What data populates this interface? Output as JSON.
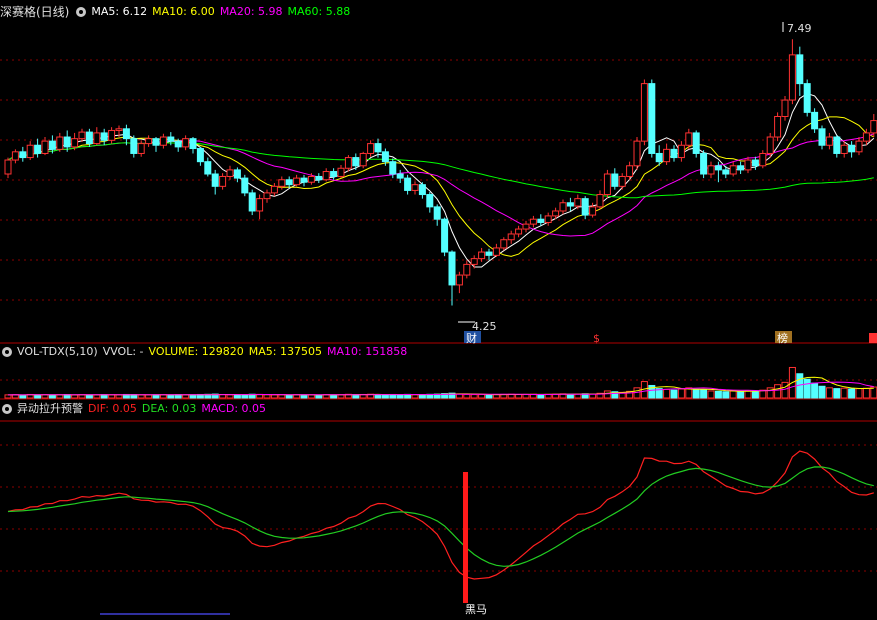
{
  "main_header": {
    "title": "深赛格(日线)",
    "ma5": "MA5: 6.12",
    "ma10": "MA10: 6.00",
    "ma20": "MA20: 5.98",
    "ma60": "MA60: 5.88"
  },
  "vol_header": {
    "name": "VOL-TDX(5,10)",
    "vvol": "VVOL: -",
    "volume": "VOLUME: 129820",
    "ma5": "MA5: 137505",
    "ma10": "MA10: 151858"
  },
  "macd_header": {
    "name": "异动拉升预警",
    "dif": "DIF: 0.05",
    "dea": "DEA: 0.03",
    "macd": "MACD: 0.05"
  },
  "annotations": {
    "high": "7.49",
    "low": "4.25",
    "marker_cai": "财",
    "marker_dollar": "$",
    "marker_bang": "榜",
    "signal": "黑马"
  },
  "colors": {
    "up": "#ff3232",
    "down": "#54ffff",
    "ma5": "#ffffff",
    "ma10": "#ffff00",
    "ma20": "#ff00ff",
    "ma60": "#00ff00",
    "dif": "#ff2020",
    "dea": "#22cc22",
    "grid": "#8b0000"
  },
  "chart_data": [
    {
      "type": "candlestick",
      "title": "深赛格(日线)",
      "ylim": [
        4.0,
        7.7
      ],
      "annotations": [
        {
          "label": "7.49",
          "value": 7.49
        },
        {
          "label": "4.25",
          "value": 4.25
        }
      ],
      "series": [
        {
          "name": "MA5",
          "value": 6.12
        },
        {
          "name": "MA10",
          "value": 6.0
        },
        {
          "name": "MA20",
          "value": 5.98
        },
        {
          "name": "MA60",
          "value": 5.88
        }
      ],
      "candles": [
        [
          5.85,
          6.02,
          6.05,
          5.8
        ],
        [
          6.02,
          6.12,
          6.15,
          5.98
        ],
        [
          6.12,
          6.05,
          6.18,
          6.0
        ],
        [
          6.05,
          6.2,
          6.25,
          6.02
        ],
        [
          6.2,
          6.1,
          6.28,
          6.05
        ],
        [
          6.1,
          6.25,
          6.3,
          6.08
        ],
        [
          6.25,
          6.15,
          6.32,
          6.1
        ],
        [
          6.15,
          6.3,
          6.35,
          6.12
        ],
        [
          6.3,
          6.18,
          6.38,
          6.12
        ],
        [
          6.18,
          6.28,
          6.35,
          6.14
        ],
        [
          6.28,
          6.36,
          6.4,
          6.24
        ],
        [
          6.36,
          6.22,
          6.4,
          6.18
        ],
        [
          6.22,
          6.35,
          6.42,
          6.2
        ],
        [
          6.35,
          6.26,
          6.4,
          6.2
        ],
        [
          6.26,
          6.38,
          6.42,
          6.22
        ],
        [
          6.38,
          6.4,
          6.44,
          6.3
        ],
        [
          6.4,
          6.28,
          6.45,
          6.2
        ],
        [
          6.28,
          6.1,
          6.32,
          6.05
        ],
        [
          6.1,
          6.22,
          6.26,
          6.06
        ],
        [
          6.22,
          6.28,
          6.32,
          6.18
        ],
        [
          6.28,
          6.2,
          6.3,
          6.12
        ],
        [
          6.2,
          6.3,
          6.34,
          6.16
        ],
        [
          6.3,
          6.25,
          6.36,
          6.2
        ],
        [
          6.25,
          6.18,
          6.28,
          6.12
        ],
        [
          6.18,
          6.28,
          6.32,
          6.14
        ],
        [
          6.28,
          6.16,
          6.3,
          6.1
        ],
        [
          6.16,
          6.0,
          6.18,
          5.95
        ],
        [
          6.0,
          5.85,
          6.05,
          5.82
        ],
        [
          5.85,
          5.7,
          5.9,
          5.6
        ],
        [
          5.7,
          5.82,
          5.86,
          5.66
        ],
        [
          5.82,
          5.9,
          5.95,
          5.78
        ],
        [
          5.9,
          5.8,
          5.93,
          5.75
        ],
        [
          5.8,
          5.62,
          5.84,
          5.58
        ],
        [
          5.62,
          5.4,
          5.66,
          5.35
        ],
        [
          5.4,
          5.55,
          5.6,
          5.3
        ],
        [
          5.55,
          5.62,
          5.66,
          5.5
        ],
        [
          5.62,
          5.7,
          5.74,
          5.58
        ],
        [
          5.7,
          5.78,
          5.82,
          5.66
        ],
        [
          5.78,
          5.72,
          5.82,
          5.68
        ],
        [
          5.72,
          5.8,
          5.84,
          5.7
        ],
        [
          5.8,
          5.75,
          5.84,
          5.7
        ],
        [
          5.75,
          5.82,
          5.86,
          5.72
        ],
        [
          5.82,
          5.78,
          5.86,
          5.74
        ],
        [
          5.78,
          5.88,
          5.92,
          5.76
        ],
        [
          5.88,
          5.82,
          5.92,
          5.78
        ],
        [
          5.82,
          5.92,
          5.96,
          5.8
        ],
        [
          5.92,
          6.05,
          6.08,
          5.88
        ],
        [
          6.05,
          5.95,
          6.1,
          5.9
        ],
        [
          5.95,
          6.1,
          6.12,
          5.92
        ],
        [
          6.1,
          6.22,
          6.26,
          6.06
        ],
        [
          6.22,
          6.12,
          6.28,
          6.05
        ],
        [
          6.12,
          6.0,
          6.16,
          5.95
        ],
        [
          6.0,
          5.85,
          6.04,
          5.8
        ],
        [
          5.85,
          5.8,
          5.9,
          5.74
        ],
        [
          5.8,
          5.65,
          5.84,
          5.6
        ],
        [
          5.65,
          5.72,
          5.76,
          5.6
        ],
        [
          5.72,
          5.6,
          5.75,
          5.55
        ],
        [
          5.6,
          5.45,
          5.63,
          5.38
        ],
        [
          5.45,
          5.3,
          5.48,
          5.22
        ],
        [
          5.3,
          4.9,
          5.32,
          4.85
        ],
        [
          4.9,
          4.5,
          4.92,
          4.25
        ],
        [
          4.5,
          4.62,
          4.66,
          4.4
        ],
        [
          4.62,
          4.75,
          4.8,
          4.58
        ],
        [
          4.75,
          4.82,
          4.86,
          4.7
        ],
        [
          4.82,
          4.9,
          4.95,
          4.78
        ],
        [
          4.9,
          4.86,
          4.94,
          4.8
        ],
        [
          4.86,
          4.95,
          5.0,
          4.84
        ],
        [
          4.95,
          5.05,
          5.08,
          4.92
        ],
        [
          5.05,
          5.12,
          5.16,
          5.0
        ],
        [
          5.12,
          5.18,
          5.22,
          5.08
        ],
        [
          5.18,
          5.24,
          5.28,
          5.14
        ],
        [
          5.24,
          5.3,
          5.34,
          5.2
        ],
        [
          5.3,
          5.26,
          5.36,
          5.22
        ],
        [
          5.26,
          5.34,
          5.38,
          5.22
        ],
        [
          5.34,
          5.4,
          5.44,
          5.3
        ],
        [
          5.4,
          5.5,
          5.54,
          5.36
        ],
        [
          5.5,
          5.46,
          5.56,
          5.4
        ],
        [
          5.46,
          5.55,
          5.6,
          5.42
        ],
        [
          5.55,
          5.35,
          5.58,
          5.3
        ],
        [
          5.35,
          5.45,
          5.5,
          5.32
        ],
        [
          5.45,
          5.6,
          5.65,
          5.42
        ],
        [
          5.6,
          5.85,
          5.9,
          5.56
        ],
        [
          5.85,
          5.7,
          5.92,
          5.66
        ],
        [
          5.7,
          5.82,
          5.86,
          5.66
        ],
        [
          5.82,
          5.95,
          6.0,
          5.78
        ],
        [
          5.95,
          6.25,
          6.3,
          5.9
        ],
        [
          6.25,
          6.95,
          7.0,
          6.2
        ],
        [
          6.95,
          6.1,
          7.0,
          6.05
        ],
        [
          6.1,
          6.0,
          6.2,
          5.95
        ],
        [
          6.0,
          6.15,
          6.22,
          5.96
        ],
        [
          6.15,
          6.05,
          6.2,
          6.0
        ],
        [
          6.05,
          6.2,
          6.25,
          6.0
        ],
        [
          6.2,
          6.35,
          6.4,
          6.15
        ],
        [
          6.35,
          6.1,
          6.38,
          6.05
        ],
        [
          6.1,
          5.85,
          6.14,
          5.8
        ],
        [
          5.85,
          5.95,
          6.0,
          5.8
        ],
        [
          5.95,
          5.9,
          6.0,
          5.75
        ],
        [
          5.9,
          5.85,
          5.95,
          5.8
        ],
        [
          5.85,
          5.95,
          6.0,
          5.82
        ],
        [
          5.95,
          5.9,
          6.0,
          5.85
        ],
        [
          5.9,
          6.02,
          6.06,
          5.86
        ],
        [
          6.02,
          5.95,
          6.06,
          5.9
        ],
        [
          5.95,
          6.1,
          6.14,
          5.92
        ],
        [
          6.1,
          6.3,
          6.35,
          6.05
        ],
        [
          6.3,
          6.55,
          6.6,
          6.25
        ],
        [
          6.55,
          6.75,
          6.8,
          6.5
        ],
        [
          6.75,
          7.3,
          7.49,
          6.7
        ],
        [
          7.3,
          6.95,
          7.4,
          6.8
        ],
        [
          6.95,
          6.6,
          7.0,
          6.55
        ],
        [
          6.6,
          6.4,
          6.65,
          6.35
        ],
        [
          6.4,
          6.2,
          6.44,
          6.15
        ],
        [
          6.2,
          6.3,
          6.35,
          6.15
        ],
        [
          6.3,
          6.1,
          6.32,
          6.05
        ],
        [
          6.1,
          6.2,
          6.25,
          6.05
        ],
        [
          6.2,
          6.12,
          6.25,
          6.05
        ],
        [
          6.12,
          6.25,
          6.3,
          6.08
        ],
        [
          6.25,
          6.35,
          6.4,
          6.2
        ],
        [
          6.35,
          6.5,
          6.58,
          6.3
        ]
      ]
    },
    {
      "type": "bar",
      "title": "VOL-TDX(5,10)",
      "ylim": [
        0,
        460000
      ],
      "series": [
        {
          "name": "VOLUME",
          "value": 129820
        },
        {
          "name": "MA5",
          "value": 137505
        },
        {
          "name": "MA10",
          "value": 151858
        }
      ],
      "values": [
        40000,
        42000,
        38000,
        45000,
        40000,
        43000,
        39000,
        41000,
        44000,
        38000,
        42000,
        40000,
        39000,
        43000,
        41000,
        40000,
        45000,
        44000,
        40000,
        39000,
        41000,
        42000,
        40000,
        43000,
        40000,
        41000,
        45000,
        47000,
        50000,
        43000,
        40000,
        41000,
        43000,
        48000,
        46000,
        42000,
        40000,
        41000,
        39000,
        42000,
        40000,
        41000,
        39000,
        43000,
        40000,
        42000,
        47000,
        43000,
        45000,
        48000,
        44000,
        43000,
        45000,
        42000,
        46000,
        41000,
        43000,
        47000,
        50000,
        56000,
        62000,
        50000,
        46000,
        44000,
        45000,
        41000,
        43000,
        46000,
        48000,
        45000,
        46000,
        48000,
        44000,
        47000,
        49000,
        53000,
        48000,
        51000,
        54000,
        50000,
        60000,
        90000,
        80000,
        72000,
        85000,
        130000,
        210000,
        160000,
        120000,
        110000,
        100000,
        115000,
        130000,
        110000,
        105000,
        90000,
        85000,
        80000,
        90000,
        85000,
        95000,
        88000,
        100000,
        130000,
        170000,
        200000,
        390000,
        310000,
        240000,
        190000,
        150000,
        130000,
        120000,
        125000,
        115000,
        120000,
        125000,
        140000
      ]
    },
    {
      "type": "line",
      "title": "异动拉升预警",
      "ylim": [
        -0.42,
        0.42
      ],
      "series": [
        {
          "name": "DIF",
          "value": 0.05
        },
        {
          "name": "DEA",
          "value": 0.03
        },
        {
          "name": "MACD",
          "value": 0.05
        }
      ],
      "annotations": [
        {
          "label": "黑马",
          "index": 61
        }
      ]
    }
  ]
}
